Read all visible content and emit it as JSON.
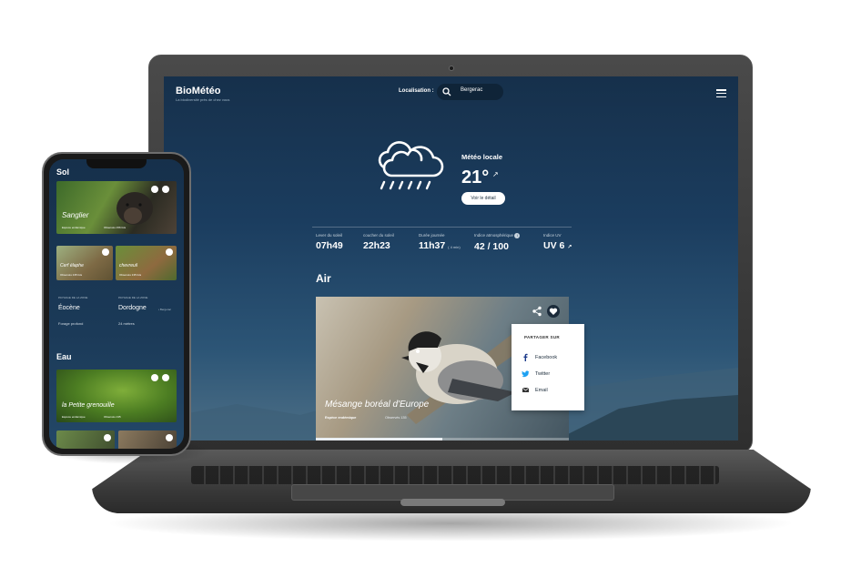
{
  "laptop": {
    "brand": "BioMétéo",
    "brand_tagline": "La biodiversité près de chez vous",
    "location_label": "Localisation :",
    "location_value": "Bergerac",
    "weather": {
      "title": "Météo locale",
      "temperature": "21°",
      "detail_button": "Voir le détail",
      "icon": "cloud-rain-icon"
    },
    "stats": [
      {
        "label": "Lever du soleil",
        "value": "07h49"
      },
      {
        "label": "coucher du soleil",
        "value": "22h23"
      },
      {
        "label": "Durée journée",
        "value": "11h37",
        "unit": "( 4 min)"
      },
      {
        "label": "Indice atmosphérique",
        "value": "42 / 100"
      },
      {
        "label": "Indice UV",
        "value": "UV 6"
      }
    ],
    "air_section": {
      "title": "Air",
      "card": {
        "name": "Mésange boréal d'Europe",
        "subtitle": "Espèce endémique",
        "observations": "Observés 135",
        "progress": 0.5
      }
    },
    "share_popup": {
      "title": "PARTAGER SUR",
      "items": [
        {
          "label": "Facebook",
          "icon": "facebook-icon"
        },
        {
          "label": "Twitter",
          "icon": "twitter-icon"
        },
        {
          "label": "Email",
          "icon": "email-icon"
        }
      ]
    }
  },
  "phone": {
    "sol_title": "Sol",
    "cards": [
      {
        "name": "Sanglier",
        "subtitle": "Espèce endémique",
        "observations": "Observés 156 fois"
      },
      {
        "name": "Cerf élaphe",
        "subtitle": "Observés 135 fois"
      },
      {
        "name": "chevreuil",
        "subtitle": "Observés 135 fois"
      }
    ],
    "info": {
      "label_1": "PAYSAGE DE LA ZONE",
      "label_2": "PAYSAGE DE LA ZONE",
      "value_1": "Éocène",
      "value_2": "Dordogne",
      "extra_2": "• Bergerac",
      "small_1": "Forage profond",
      "small_2": "24 mètres"
    },
    "eau_title": "Eau",
    "eau_card": {
      "name": "la Petite grenouille",
      "subtitle": "Espèce endémique",
      "observations": "Observés 135"
    }
  },
  "colors": {
    "screen_bg": "#1b3d5f",
    "card_white": "#ffffff",
    "facebook": "#1b3a8a",
    "twitter": "#1da1f2"
  }
}
